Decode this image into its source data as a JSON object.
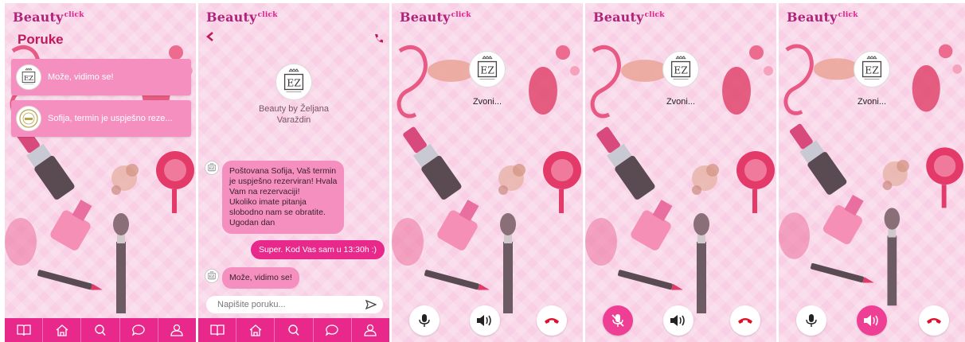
{
  "app": {
    "logo_text": "Beauty",
    "logo_sup": "click"
  },
  "colors": {
    "accent": "#e8288a",
    "card": "#f48fbf",
    "background": "#f8cfe4",
    "hangup": "#e0102a"
  },
  "inbox": {
    "title": "Poruke",
    "items": [
      {
        "preview": "Može, vidimo se!",
        "avatar_icon": "ez-logo-icon"
      },
      {
        "preview": "Sofija, termin je uspješno reze...",
        "avatar_icon": "salon-logo-icon"
      }
    ]
  },
  "bottom_nav": [
    {
      "name": "book-icon"
    },
    {
      "name": "home-icon"
    },
    {
      "name": "search-icon"
    },
    {
      "name": "chat-icon"
    },
    {
      "name": "profile-icon"
    }
  ],
  "chat": {
    "business_name_line1": "Beauty by Željana",
    "business_name_line2": "Varaždin",
    "incoming_lines": [
      "Poštovana Sofija, Vaš termin",
      "je uspješno rezerviran! Hvala",
      "Vam na rezervaciji!",
      "Ukoliko imate pitanja",
      "slobodno nam se obratite.",
      "Ugodan dan"
    ],
    "outgoing": "Super. Kod Vas sam u 13:30h :)",
    "incoming_reply": "Može, vidimo se!",
    "input_placeholder": "Napišite poruku..."
  },
  "calls": [
    {
      "status": "Zvoni...",
      "mic_muted": false,
      "speaker_on": false
    },
    {
      "status": "Zvoni...",
      "mic_muted": true,
      "speaker_on": false
    },
    {
      "status": "Zvoni...",
      "mic_muted": false,
      "speaker_on": true
    }
  ]
}
